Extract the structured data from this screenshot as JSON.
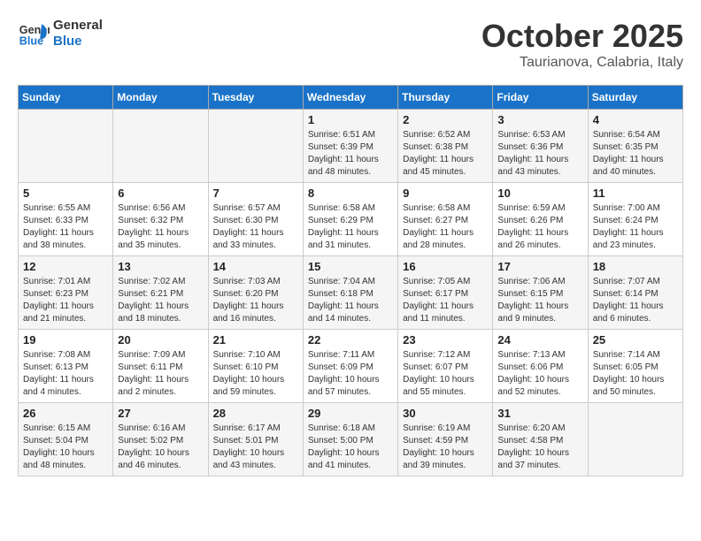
{
  "logo": {
    "line1": "General",
    "line2": "Blue"
  },
  "title": "October 2025",
  "subtitle": "Taurianova, Calabria, Italy",
  "weekdays": [
    "Sunday",
    "Monday",
    "Tuesday",
    "Wednesday",
    "Thursday",
    "Friday",
    "Saturday"
  ],
  "weeks": [
    [
      {
        "day": "",
        "info": ""
      },
      {
        "day": "",
        "info": ""
      },
      {
        "day": "",
        "info": ""
      },
      {
        "day": "1",
        "info": "Sunrise: 6:51 AM\nSunset: 6:39 PM\nDaylight: 11 hours\nand 48 minutes."
      },
      {
        "day": "2",
        "info": "Sunrise: 6:52 AM\nSunset: 6:38 PM\nDaylight: 11 hours\nand 45 minutes."
      },
      {
        "day": "3",
        "info": "Sunrise: 6:53 AM\nSunset: 6:36 PM\nDaylight: 11 hours\nand 43 minutes."
      },
      {
        "day": "4",
        "info": "Sunrise: 6:54 AM\nSunset: 6:35 PM\nDaylight: 11 hours\nand 40 minutes."
      }
    ],
    [
      {
        "day": "5",
        "info": "Sunrise: 6:55 AM\nSunset: 6:33 PM\nDaylight: 11 hours\nand 38 minutes."
      },
      {
        "day": "6",
        "info": "Sunrise: 6:56 AM\nSunset: 6:32 PM\nDaylight: 11 hours\nand 35 minutes."
      },
      {
        "day": "7",
        "info": "Sunrise: 6:57 AM\nSunset: 6:30 PM\nDaylight: 11 hours\nand 33 minutes."
      },
      {
        "day": "8",
        "info": "Sunrise: 6:58 AM\nSunset: 6:29 PM\nDaylight: 11 hours\nand 31 minutes."
      },
      {
        "day": "9",
        "info": "Sunrise: 6:58 AM\nSunset: 6:27 PM\nDaylight: 11 hours\nand 28 minutes."
      },
      {
        "day": "10",
        "info": "Sunrise: 6:59 AM\nSunset: 6:26 PM\nDaylight: 11 hours\nand 26 minutes."
      },
      {
        "day": "11",
        "info": "Sunrise: 7:00 AM\nSunset: 6:24 PM\nDaylight: 11 hours\nand 23 minutes."
      }
    ],
    [
      {
        "day": "12",
        "info": "Sunrise: 7:01 AM\nSunset: 6:23 PM\nDaylight: 11 hours\nand 21 minutes."
      },
      {
        "day": "13",
        "info": "Sunrise: 7:02 AM\nSunset: 6:21 PM\nDaylight: 11 hours\nand 18 minutes."
      },
      {
        "day": "14",
        "info": "Sunrise: 7:03 AM\nSunset: 6:20 PM\nDaylight: 11 hours\nand 16 minutes."
      },
      {
        "day": "15",
        "info": "Sunrise: 7:04 AM\nSunset: 6:18 PM\nDaylight: 11 hours\nand 14 minutes."
      },
      {
        "day": "16",
        "info": "Sunrise: 7:05 AM\nSunset: 6:17 PM\nDaylight: 11 hours\nand 11 minutes."
      },
      {
        "day": "17",
        "info": "Sunrise: 7:06 AM\nSunset: 6:15 PM\nDaylight: 11 hours\nand 9 minutes."
      },
      {
        "day": "18",
        "info": "Sunrise: 7:07 AM\nSunset: 6:14 PM\nDaylight: 11 hours\nand 6 minutes."
      }
    ],
    [
      {
        "day": "19",
        "info": "Sunrise: 7:08 AM\nSunset: 6:13 PM\nDaylight: 11 hours\nand 4 minutes."
      },
      {
        "day": "20",
        "info": "Sunrise: 7:09 AM\nSunset: 6:11 PM\nDaylight: 11 hours\nand 2 minutes."
      },
      {
        "day": "21",
        "info": "Sunrise: 7:10 AM\nSunset: 6:10 PM\nDaylight: 10 hours\nand 59 minutes."
      },
      {
        "day": "22",
        "info": "Sunrise: 7:11 AM\nSunset: 6:09 PM\nDaylight: 10 hours\nand 57 minutes."
      },
      {
        "day": "23",
        "info": "Sunrise: 7:12 AM\nSunset: 6:07 PM\nDaylight: 10 hours\nand 55 minutes."
      },
      {
        "day": "24",
        "info": "Sunrise: 7:13 AM\nSunset: 6:06 PM\nDaylight: 10 hours\nand 52 minutes."
      },
      {
        "day": "25",
        "info": "Sunrise: 7:14 AM\nSunset: 6:05 PM\nDaylight: 10 hours\nand 50 minutes."
      }
    ],
    [
      {
        "day": "26",
        "info": "Sunrise: 6:15 AM\nSunset: 5:04 PM\nDaylight: 10 hours\nand 48 minutes."
      },
      {
        "day": "27",
        "info": "Sunrise: 6:16 AM\nSunset: 5:02 PM\nDaylight: 10 hours\nand 46 minutes."
      },
      {
        "day": "28",
        "info": "Sunrise: 6:17 AM\nSunset: 5:01 PM\nDaylight: 10 hours\nand 43 minutes."
      },
      {
        "day": "29",
        "info": "Sunrise: 6:18 AM\nSunset: 5:00 PM\nDaylight: 10 hours\nand 41 minutes."
      },
      {
        "day": "30",
        "info": "Sunrise: 6:19 AM\nSunset: 4:59 PM\nDaylight: 10 hours\nand 39 minutes."
      },
      {
        "day": "31",
        "info": "Sunrise: 6:20 AM\nSunset: 4:58 PM\nDaylight: 10 hours\nand 37 minutes."
      },
      {
        "day": "",
        "info": ""
      }
    ]
  ]
}
